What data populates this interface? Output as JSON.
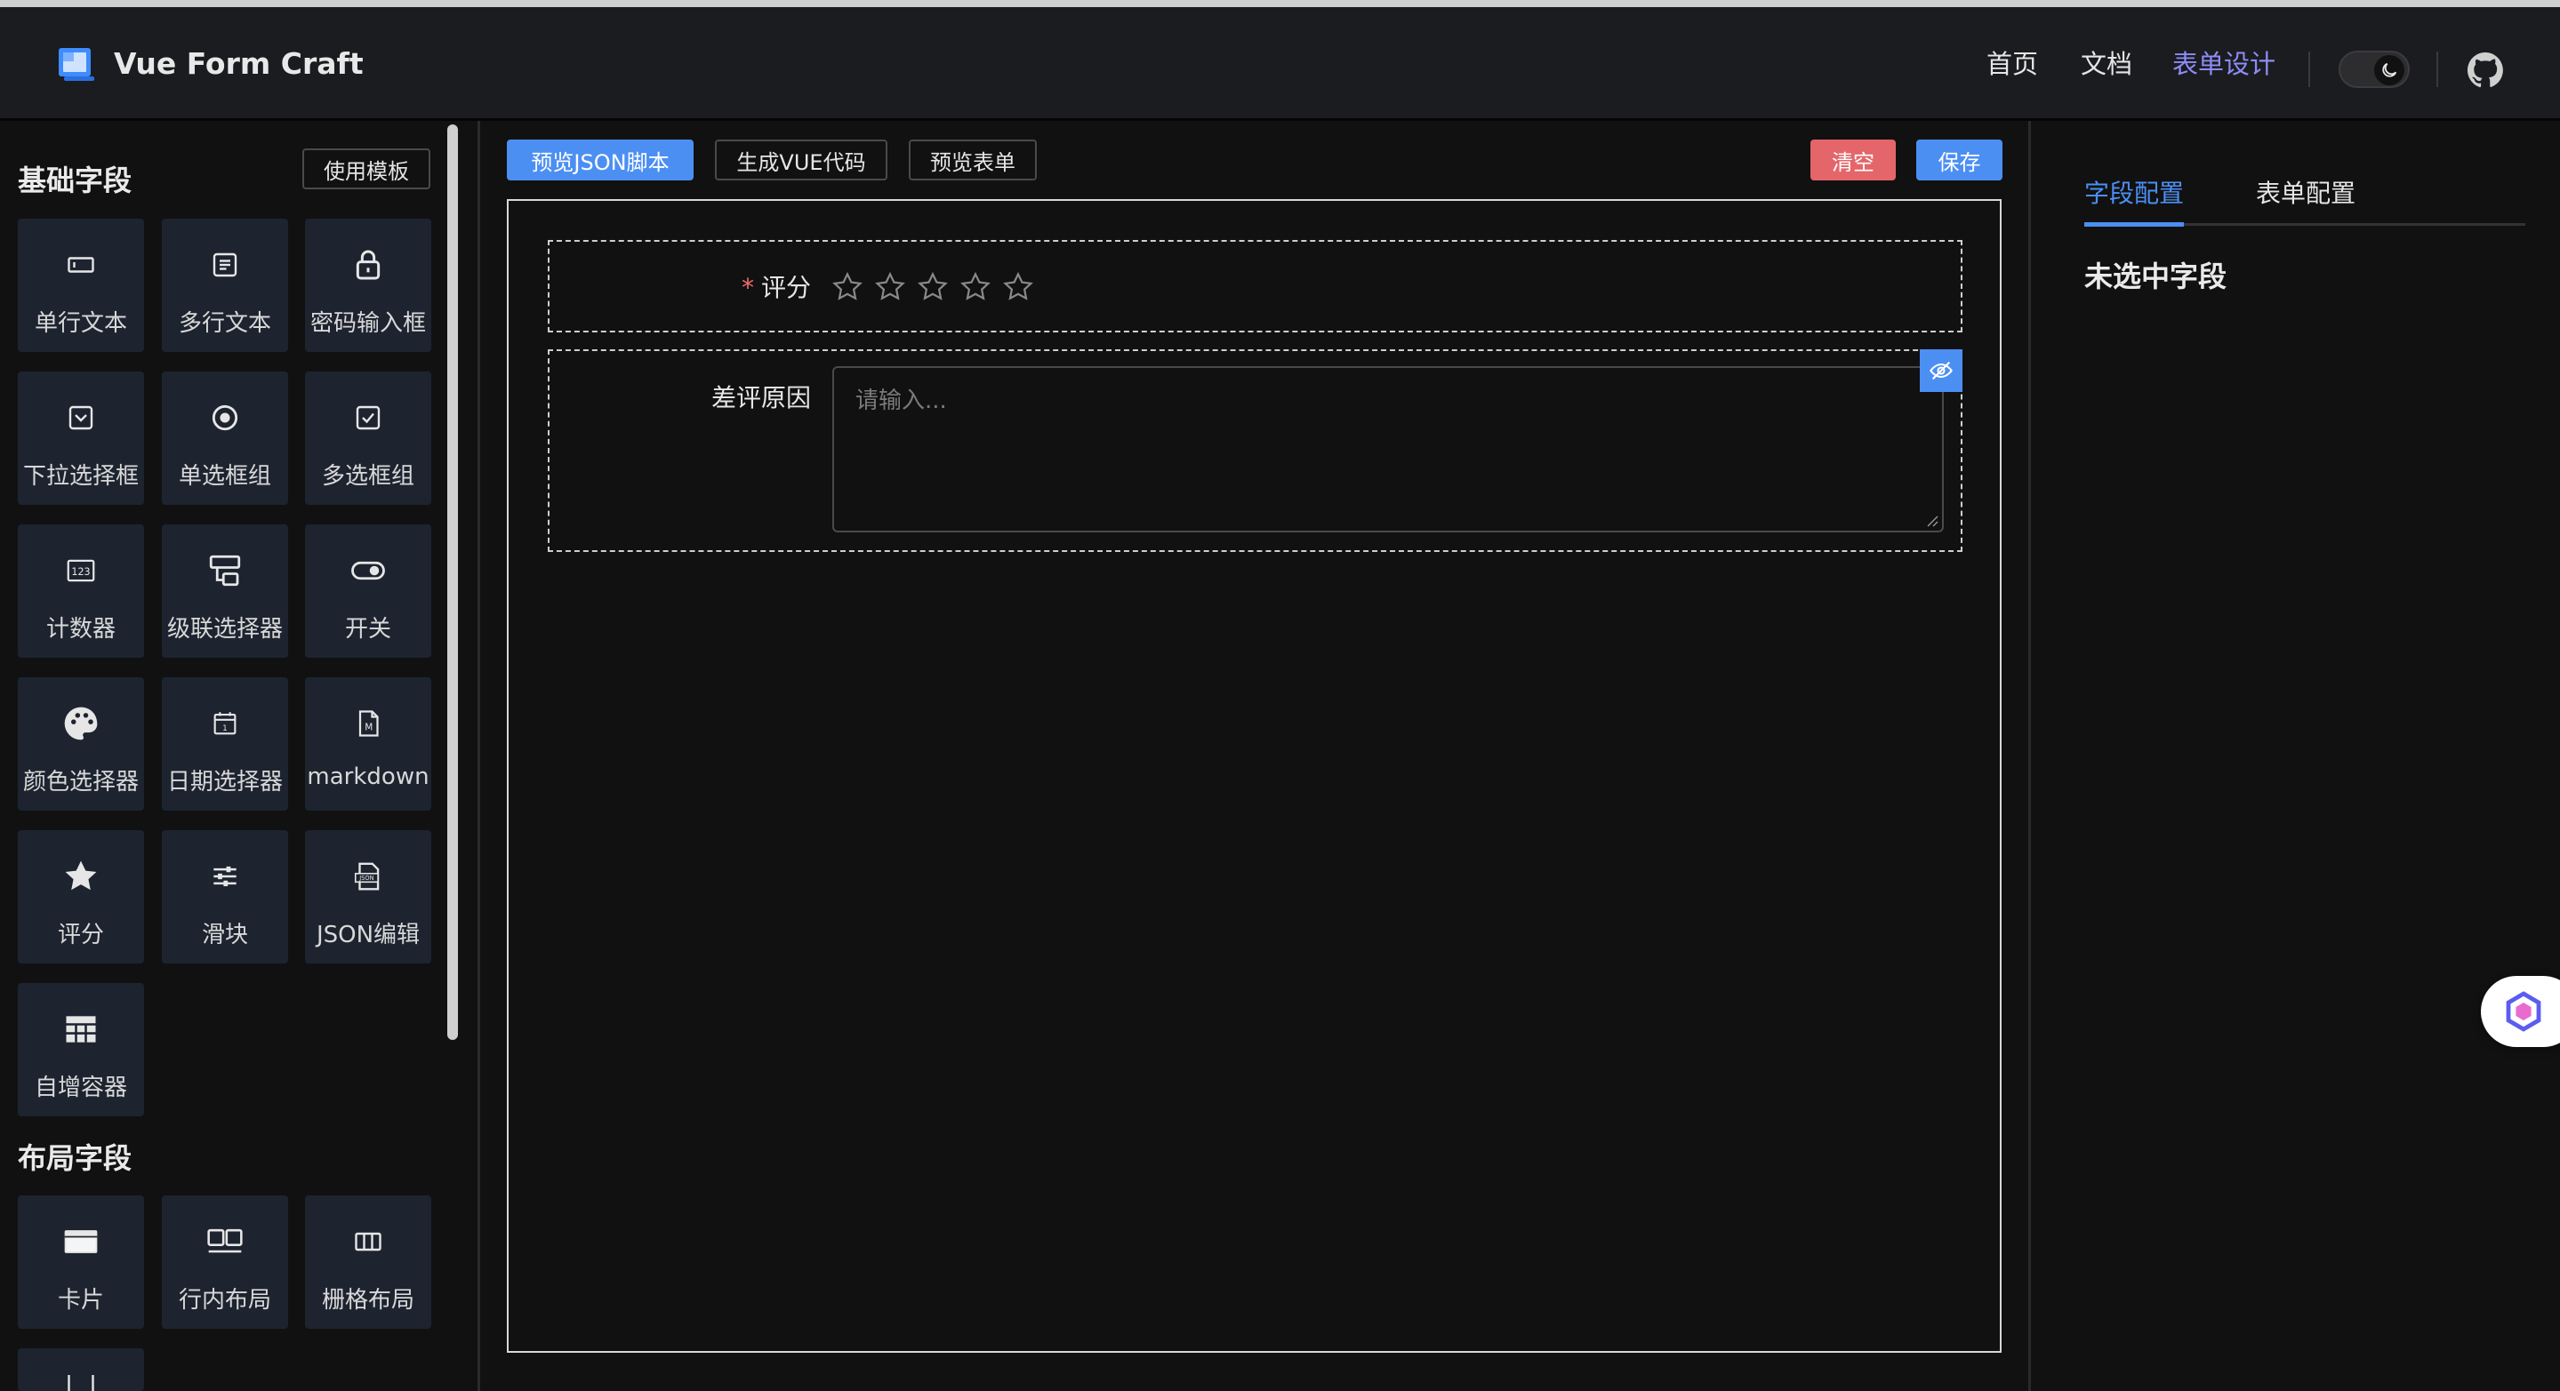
{
  "header": {
    "brand": "Vue Form Craft",
    "nav": [
      {
        "label": "首页"
      },
      {
        "label": "文档"
      },
      {
        "label": "表单设计"
      }
    ],
    "accent": "#8d8cf7"
  },
  "sidebar": {
    "basic_title": "基础字段",
    "template_button": "使用模板",
    "basic_items": [
      {
        "label": "单行文本",
        "icon": "input-icon"
      },
      {
        "label": "多行文本",
        "icon": "textarea-icon"
      },
      {
        "label": "密码输入框",
        "icon": "lock-icon"
      },
      {
        "label": "下拉选择框",
        "icon": "select-icon"
      },
      {
        "label": "单选框组",
        "icon": "radio-icon"
      },
      {
        "label": "多选框组",
        "icon": "checkbox-icon"
      },
      {
        "label": "计数器",
        "icon": "number-icon"
      },
      {
        "label": "级联选择器",
        "icon": "cascader-icon"
      },
      {
        "label": "开关",
        "icon": "switch-icon"
      },
      {
        "label": "颜色选择器",
        "icon": "palette-icon"
      },
      {
        "label": "日期选择器",
        "icon": "calendar-icon"
      },
      {
        "label": "markdown",
        "icon": "markdown-icon"
      },
      {
        "label": "评分",
        "icon": "star-icon"
      },
      {
        "label": "滑块",
        "icon": "slider-icon"
      },
      {
        "label": "JSON编辑",
        "icon": "json-icon"
      },
      {
        "label": "自增容器",
        "icon": "table-icon"
      }
    ],
    "layout_title": "布局字段",
    "layout_items": [
      {
        "label": "卡片",
        "icon": "card-icon"
      },
      {
        "label": "行内布局",
        "icon": "inline-icon"
      },
      {
        "label": "栅格布局",
        "icon": "grid-icon"
      }
    ]
  },
  "toolbar": {
    "preview_json": "预览JSON脚本",
    "generate_vue": "生成VUE代码",
    "preview_form": "预览表单",
    "clear": "清空",
    "save": "保存"
  },
  "form": {
    "rating": {
      "label": "评分",
      "required_mark": "*",
      "stars": 5,
      "value": 0
    },
    "reason": {
      "label": "差评原因",
      "placeholder": "请输入..."
    }
  },
  "right_panel": {
    "tabs": [
      {
        "label": "字段配置"
      },
      {
        "label": "表单配置"
      }
    ],
    "empty_text": "未选中字段"
  },
  "colors": {
    "primary": "#4c8ff3",
    "danger": "#e4666a",
    "tile_bg": "#1d2430"
  }
}
